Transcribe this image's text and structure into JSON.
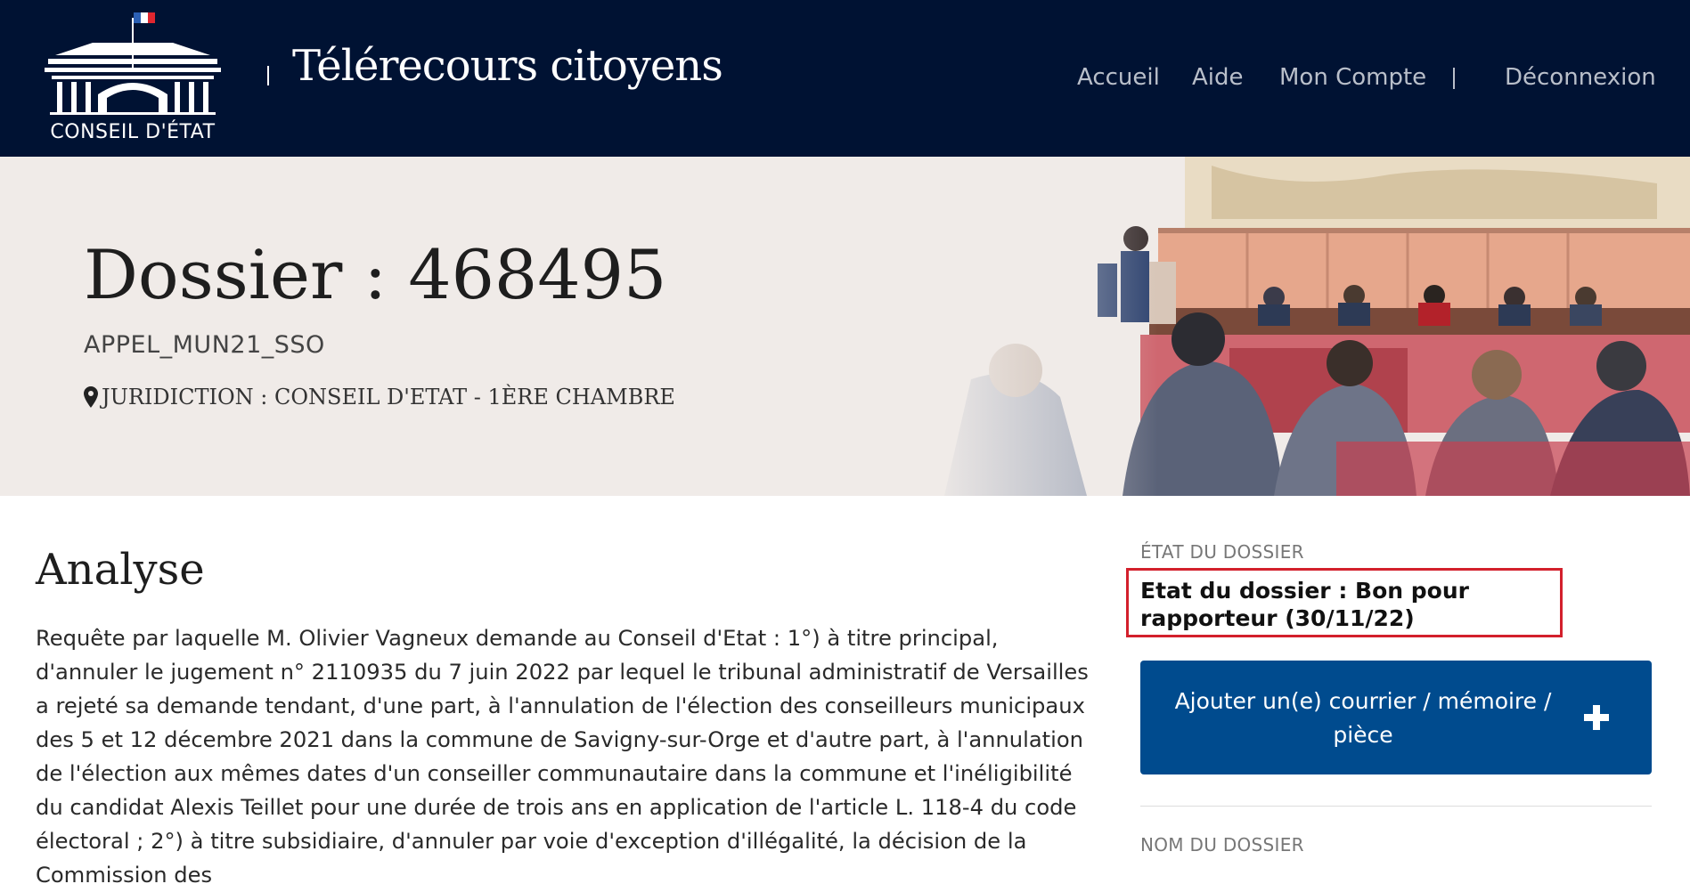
{
  "header": {
    "logo_text": "CONSEIL D'ÉTAT",
    "site_title": "Télérecours citoyens",
    "nav": {
      "accueil": "Accueil",
      "aide": "Aide",
      "mon_compte": "Mon Compte",
      "deconnexion": "Déconnexion"
    },
    "colors": {
      "background": "#001233",
      "nav_text": "#b9bfca"
    }
  },
  "banner": {
    "title": "Dossier : 468495",
    "code": "APPEL_MUN21_SSO",
    "juridiction": "JURIDICTION : CONSEIL D'ETAT - 1ÈRE CHAMBRE",
    "icon": "map-pin-icon"
  },
  "main": {
    "analyse_title": "Analyse",
    "analyse_text": "Requête par laquelle M. Olivier Vagneux demande au Conseil d'Etat : 1°) à titre principal, d'annuler le jugement n° 2110935 du 7 juin 2022 par lequel le tribunal administratif de Versailles a rejeté sa demande tendant, d'une part, à l'annulation de l'élection des conseilleurs municipaux des 5 et 12 décembre 2021 dans la commune de Savigny-sur-Orge et d'autre part, à l'annulation de l'élection aux mêmes dates d'un conseiller communautaire dans la commune et l'inéligibilité du candidat Alexis Teillet pour une durée de trois ans en application de l'article L. 118-4 du code électoral ; 2°) à titre subsidiaire, d'annuler par voie d'exception d'illégalité, la décision de la Commission des"
  },
  "sidebar": {
    "etat_label": "ÉTAT DU DOSSIER",
    "etat_value": "Etat du dossier : Bon pour rapporteur (30/11/22)",
    "ajouter_button": "Ajouter un(e) courrier / mémoire / pièce",
    "nom_label": "NOM DU DOSSIER",
    "colors": {
      "button": "#004b8e",
      "highlight_border": "#d3202c"
    }
  }
}
